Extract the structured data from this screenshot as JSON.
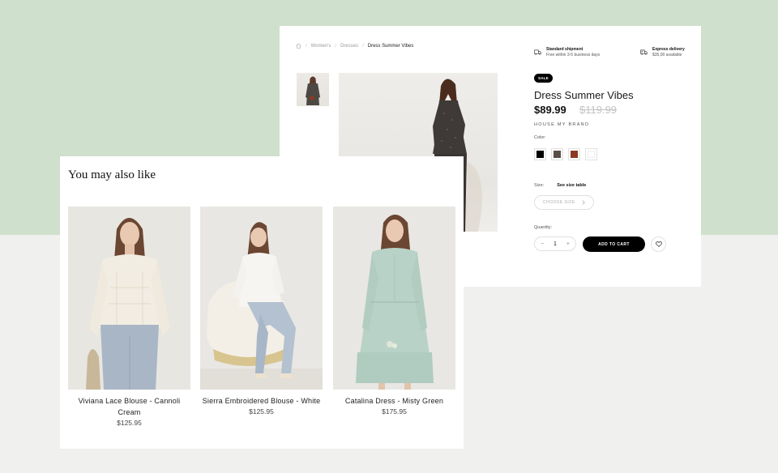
{
  "product_page": {
    "breadcrumb": [
      "Women's",
      "Dresses",
      "Dress Summer Vibes"
    ],
    "shipping": [
      {
        "title": "Standard shipment",
        "subtitle": "Free within 3-5 business days"
      },
      {
        "title": "Express delivery",
        "subtitle": "$35,00 available"
      }
    ],
    "badge": "SALE",
    "title": "Dress Summer Vibes",
    "price": "$89.99",
    "old_price": "$119.99",
    "brand": "HOUSE MY BRAND",
    "color_label": "Color:",
    "colors": [
      "#000000",
      "#5a4e49",
      "#8a3a22",
      "#ffffff"
    ],
    "size_label": "Size:",
    "size_table_link": "See size table",
    "size_placeholder": "CHOOSE SIZE",
    "quantity_label": "Quantity:",
    "quantity": "1",
    "add_to_cart": "ADD TO CART"
  },
  "recommendations": {
    "heading": "You may also like",
    "items": [
      {
        "name": "Viviana Lace Blouse - Cannoli Cream",
        "price": "$125.95"
      },
      {
        "name": "Sierra Embroidered Blouse - White",
        "price": "$125.95"
      },
      {
        "name": "Catalina Dress - Misty Green",
        "price": "$175.95"
      }
    ]
  }
}
